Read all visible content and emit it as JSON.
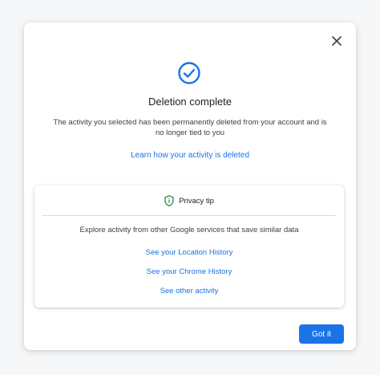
{
  "dialog": {
    "title": "Deletion complete",
    "description": "The activity you selected has been permanently deleted from your account and is no longer tied to you",
    "learn_link": "Learn how your activity is deleted",
    "close_icon": "close-icon",
    "success_icon": "check-circle-icon"
  },
  "privacy_tip": {
    "icon": "shield-icon",
    "header": "Privacy tip",
    "description": "Explore activity from other Google services that save similar data",
    "links": [
      "See your Location History",
      "See your Chrome History",
      "See other activity"
    ]
  },
  "footer": {
    "got_it_label": "Got it"
  },
  "colors": {
    "accent": "#1a73e8",
    "shield": "#1e8e3e",
    "text": "#202124"
  }
}
